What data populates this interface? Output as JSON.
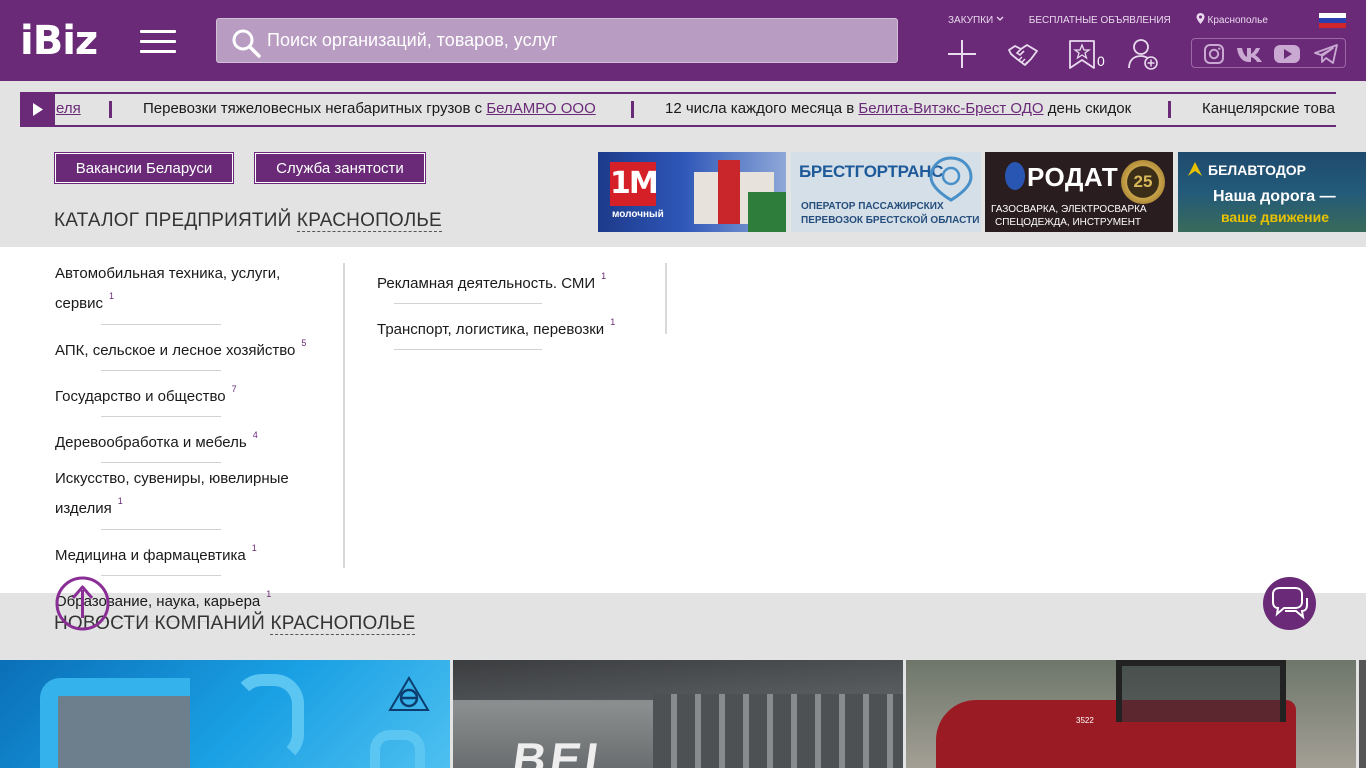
{
  "header": {
    "logo": "iBiz",
    "search_placeholder": "Поиск организаций, товаров, услуг",
    "links": {
      "purchases": "ЗАКУПКИ",
      "free_ads": "БЕСПЛАТНЫЕ ОБЪЯВЛЕНИЯ",
      "location": "Краснополье"
    },
    "favorites_count": "0",
    "colors": {
      "brand": "#6a2a78"
    }
  },
  "ticker": {
    "lead_fragment": "еля",
    "items": [
      {
        "text": "Перевозки тяжеловесных негабаритных грузов с ",
        "link": "БелАМРО ООО",
        "after": ""
      },
      {
        "text": "12 числа каждого месяца в ",
        "link": "Белита-Витэкс-Брест ОДО",
        "after": " день скидок"
      },
      {
        "text": "Канцелярские това",
        "link": "",
        "after": ""
      }
    ]
  },
  "buttons": {
    "vacancies": "Вакансии Беларуси",
    "employment": "Служба занятости"
  },
  "catalog": {
    "title": "КАТАЛОГ ПРЕДПРИЯТИЙ",
    "city": "КРАСНОПОЛЬЕ",
    "col1": [
      {
        "label": "Автомобильная техника, услуги, сервис",
        "count": "1"
      },
      {
        "label": "АПК, сельское и лесное хозяйство",
        "count": "5"
      },
      {
        "label": "Государство и общество",
        "count": "7"
      },
      {
        "label": "Деревообработка и мебель",
        "count": "4"
      },
      {
        "label": "Искусство, сувениры, ювелирные изделия",
        "count": "1"
      },
      {
        "label": "Медицина и фармацевтика",
        "count": "1"
      },
      {
        "label": "Образование, наука, карьера",
        "count": "1"
      }
    ],
    "col2": [
      {
        "label": "Рекламная деятельность. СМИ",
        "count": "1"
      },
      {
        "label": "Транспорт, логистика, перевозки",
        "count": "1"
      }
    ]
  },
  "banners": {
    "b1": {
      "big": "1M",
      "small": "молочный"
    },
    "b2": {
      "title": "БРЕСТГОРТРАНС",
      "line1": "ОПЕРАТОР ПАССАЖИРСКИХ",
      "line2": "ПЕРЕВОЗОК БРЕСТСКОЙ ОБЛАСТИ"
    },
    "b3": {
      "title": "РОДАТ",
      "line1": "ГАЗОСВАРКА, ЭЛЕКТРОСВАРКА",
      "line2": "СПЕЦОДЕЖДА, ИНСТРУМЕНТ",
      "badge": "25"
    },
    "b4": {
      "title": "БЕЛАВТОДОР",
      "line1": "Наша дорога —",
      "line2": "ваше движение"
    }
  },
  "news": {
    "title": "НОВОСТИ КОМПАНИЙ",
    "city": "КРАСНОПОЛЬЕ"
  }
}
